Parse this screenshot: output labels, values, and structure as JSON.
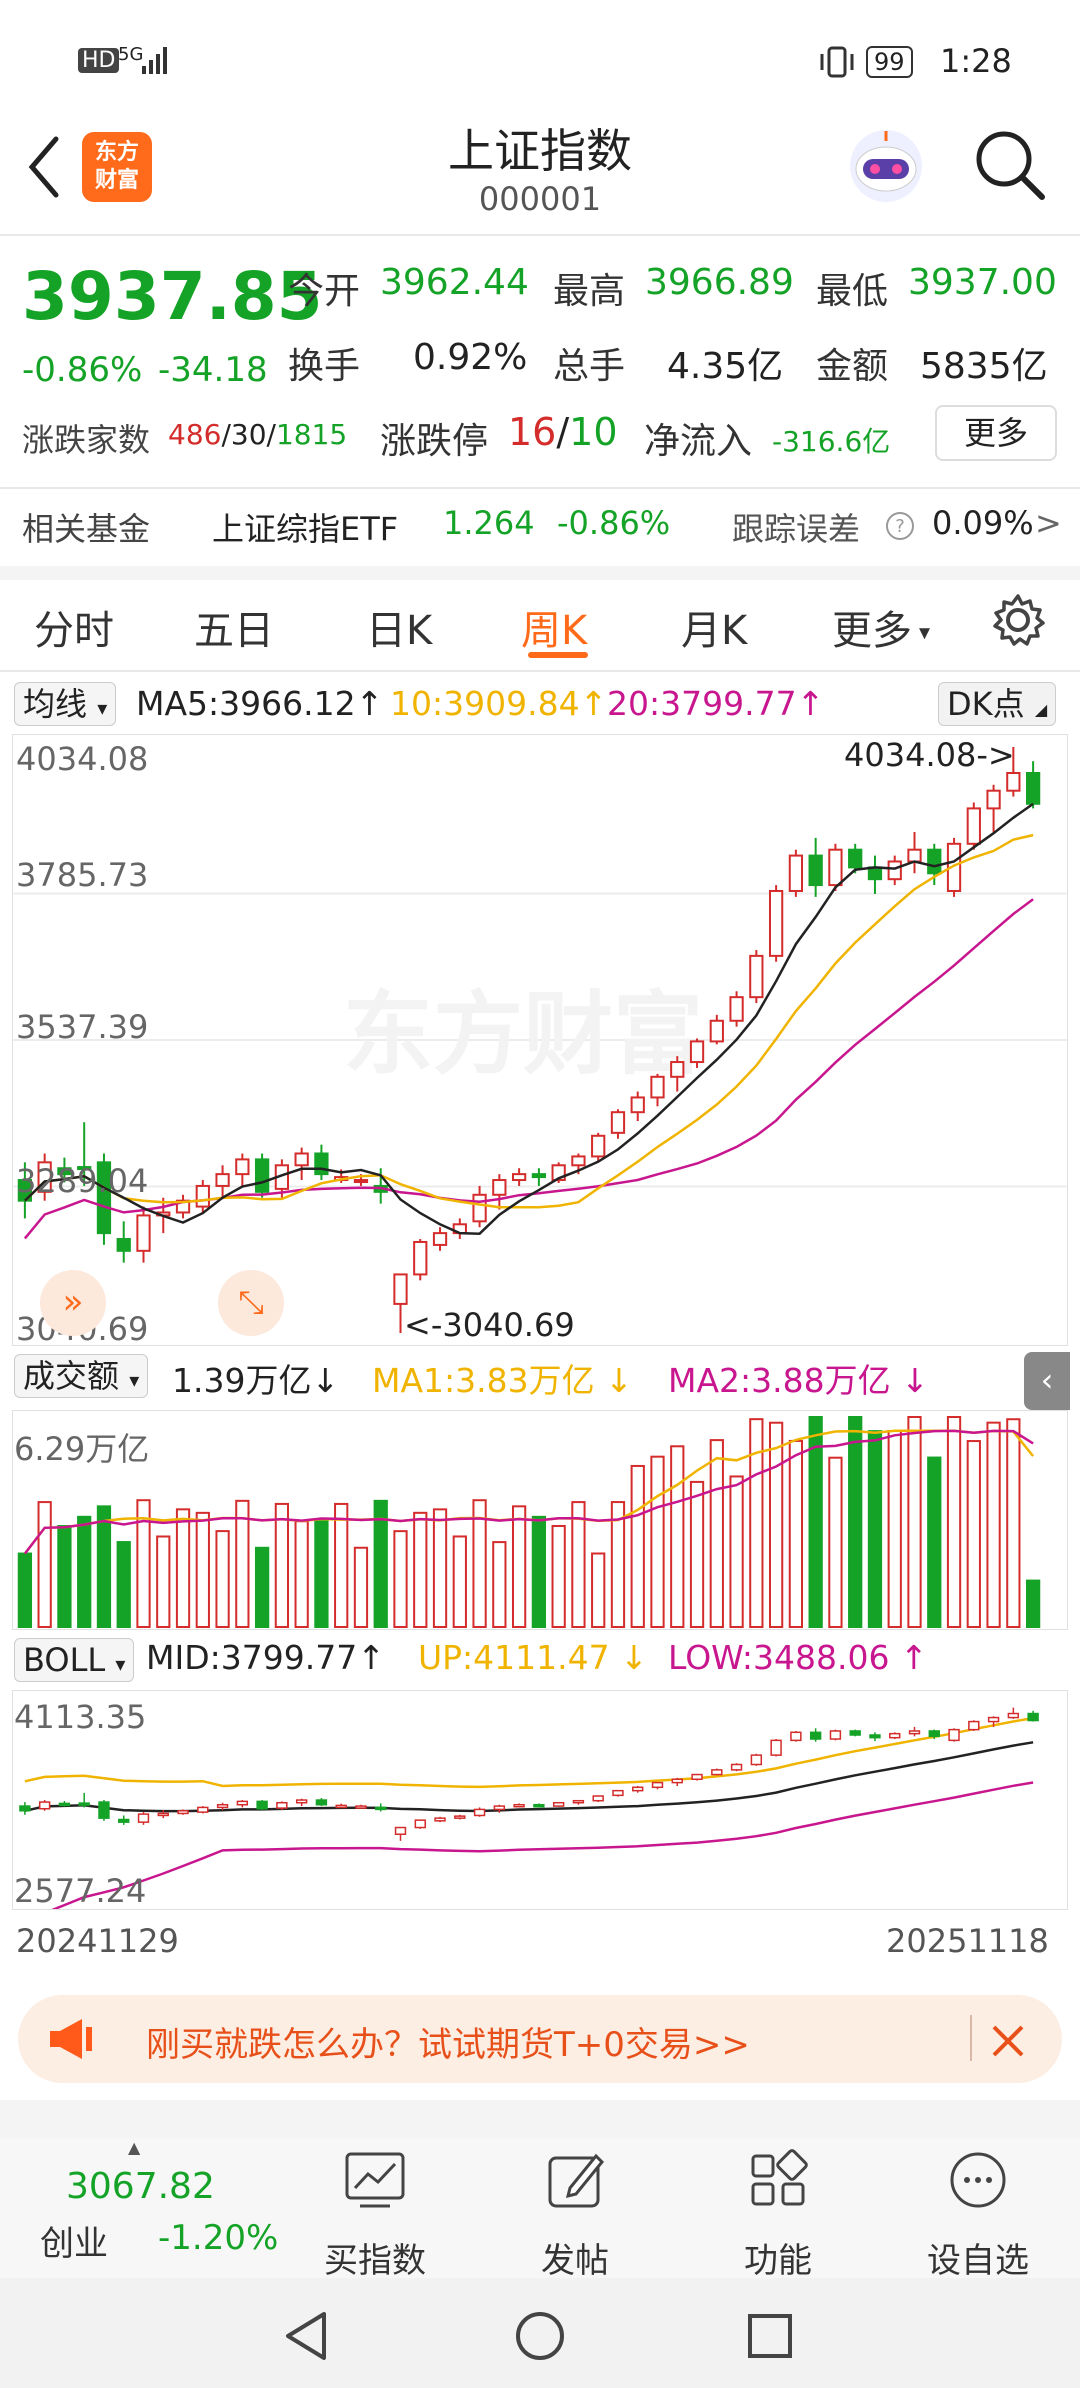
{
  "status": {
    "left_text": "HD",
    "net": "5G",
    "battery": "99",
    "time": "1:28"
  },
  "header": {
    "title": "上证指数",
    "code": "000001",
    "logo_text": "东方\n财富"
  },
  "quote": {
    "price": "3937.85",
    "change_pct": "-0.86%",
    "change": "-34.18",
    "open_label": "今开",
    "open": "3962.44",
    "high_label": "最高",
    "high": "3966.89",
    "low_label": "最低",
    "low": "3937.00",
    "turnover_label": "换手",
    "turnover": "0.92%",
    "volume_label": "总手",
    "volume": "4.35亿",
    "amount_label": "金额",
    "amount": "5835亿",
    "breadth_label": "涨跌家数",
    "breadth_up": "486",
    "breadth_flat": "30",
    "breadth_down": "1815",
    "limit_label": "涨跌停",
    "limit_up": "16",
    "limit_down": "10",
    "netflow_label": "净流入",
    "netflow": "-316.6亿",
    "more_button": "更多"
  },
  "fund": {
    "label": "相关基金",
    "name": "上证综指ETF",
    "price": "1.264",
    "change": "-0.86%",
    "tracking_label": "跟踪误差",
    "tracking_value": "0.09%",
    "arrow": ">"
  },
  "tabs": [
    "分时",
    "五日",
    "日K",
    "周K",
    "月K",
    "更多"
  ],
  "active_tab": "周K",
  "kline": {
    "ma_select": "均线",
    "ma5": "MA5:3966.12",
    "ma10": "10:3909.84",
    "ma20": "20:3799.77",
    "dk_button": "DK点",
    "y_labels": [
      "4034.08",
      "3785.73",
      "3537.39",
      "3289.04",
      "3040.69"
    ],
    "max_label": "4034.08->",
    "min_label": "<-3040.69",
    "watermark": "东方财富"
  },
  "volume": {
    "select": "成交额",
    "value": "1.39万亿",
    "ma1": "MA1:3.83万亿",
    "ma2": "MA2:3.88万亿",
    "y_label": "6.29万亿"
  },
  "boll": {
    "select": "BOLL",
    "mid": "MID:3799.77",
    "up": "UP:4111.47",
    "low": "LOW:3488.06",
    "y_top": "4113.35",
    "y_bottom": "2577.24",
    "date_start": "20241129",
    "date_end": "20251118"
  },
  "banner": {
    "text": "刚买就跌怎么办？试试期货T+0交易>>"
  },
  "bottom": {
    "index_price": "3067.82",
    "index_name": "创业",
    "index_change": "-1.20%",
    "items": [
      "买指数",
      "发帖",
      "功能",
      "设自选"
    ]
  },
  "chart_data": {
    "type": "candlestick",
    "title": "上证指数 周K",
    "ylim": [
      3040.69,
      4034.08
    ],
    "ohlc": [
      [
        3300,
        3330,
        3235,
        3265
      ],
      [
        3280,
        3345,
        3265,
        3330
      ],
      [
        3320,
        3338,
        3296,
        3310
      ],
      [
        3322,
        3398,
        3290,
        3320
      ],
      [
        3330,
        3345,
        3190,
        3210
      ],
      [
        3200,
        3230,
        3160,
        3180
      ],
      [
        3180,
        3255,
        3160,
        3240
      ],
      [
        3240,
        3270,
        3210,
        3245
      ],
      [
        3245,
        3275,
        3235,
        3265
      ],
      [
        3255,
        3300,
        3245,
        3290
      ],
      [
        3290,
        3325,
        3270,
        3310
      ],
      [
        3310,
        3345,
        3290,
        3335
      ],
      [
        3335,
        3345,
        3270,
        3280
      ],
      [
        3285,
        3335,
        3270,
        3325
      ],
      [
        3325,
        3355,
        3300,
        3345
      ],
      [
        3345,
        3360,
        3300,
        3310
      ],
      [
        3300,
        3318,
        3295,
        3305
      ],
      [
        3300,
        3310,
        3290,
        3300
      ],
      [
        3290,
        3320,
        3260,
        3280
      ],
      [
        3090,
        3140,
        3040.69,
        3140
      ],
      [
        3140,
        3200,
        3130,
        3195
      ],
      [
        3190,
        3220,
        3180,
        3210
      ],
      [
        3210,
        3235,
        3200,
        3225
      ],
      [
        3230,
        3290,
        3220,
        3275
      ],
      [
        3275,
        3310,
        3250,
        3300
      ],
      [
        3300,
        3320,
        3290,
        3310
      ],
      [
        3310,
        3320,
        3290,
        3305
      ],
      [
        3300,
        3330,
        3295,
        3325
      ],
      [
        3325,
        3345,
        3310,
        3340
      ],
      [
        3340,
        3380,
        3330,
        3375
      ],
      [
        3380,
        3420,
        3370,
        3415
      ],
      [
        3415,
        3450,
        3400,
        3440
      ],
      [
        3440,
        3480,
        3425,
        3475
      ],
      [
        3475,
        3510,
        3450,
        3500
      ],
      [
        3500,
        3540,
        3490,
        3535
      ],
      [
        3535,
        3580,
        3530,
        3570
      ],
      [
        3570,
        3620,
        3560,
        3610
      ],
      [
        3610,
        3690,
        3600,
        3680
      ],
      [
        3680,
        3800,
        3670,
        3790
      ],
      [
        3790,
        3860,
        3780,
        3850
      ],
      [
        3850,
        3880,
        3780,
        3800
      ],
      [
        3800,
        3870,
        3790,
        3860
      ],
      [
        3860,
        3870,
        3820,
        3830
      ],
      [
        3830,
        3850,
        3785,
        3810
      ],
      [
        3810,
        3850,
        3800,
        3840
      ],
      [
        3840,
        3890,
        3820,
        3860
      ],
      [
        3860,
        3870,
        3800,
        3820
      ],
      [
        3790,
        3880,
        3780,
        3870
      ],
      [
        3870,
        3940,
        3860,
        3930
      ],
      [
        3930,
        3970,
        3890,
        3960
      ],
      [
        3960,
        4034.08,
        3950,
        3990
      ],
      [
        3990,
        4010,
        3930,
        3937.85
      ]
    ],
    "volume_max": "6.29万亿"
  }
}
